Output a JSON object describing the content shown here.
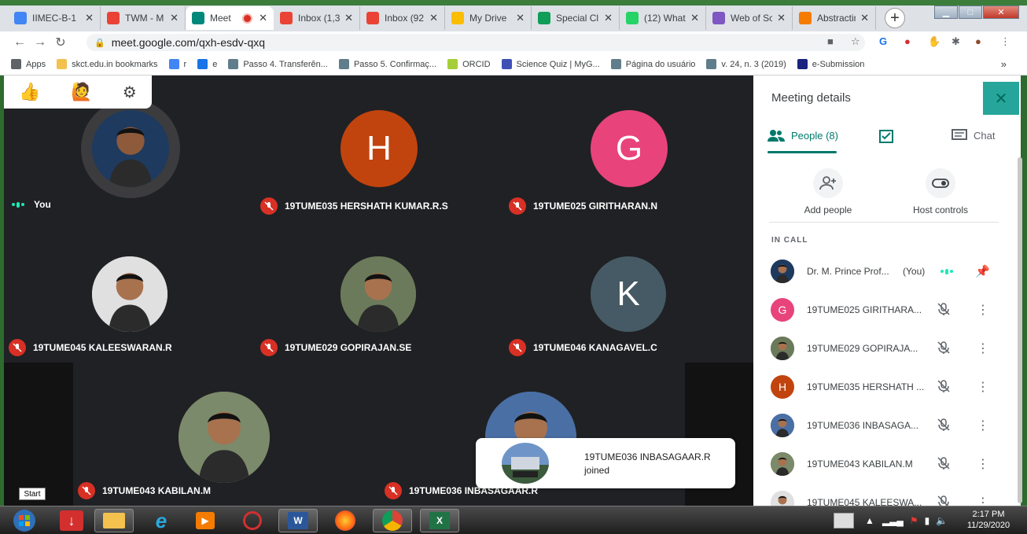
{
  "browser": {
    "tabs": [
      {
        "title": "IIMEC-B-1",
        "icon": "classroom-icon",
        "color": "#4285f4"
      },
      {
        "title": "TWM - M",
        "icon": "gmail-icon",
        "color": "#ea4335"
      },
      {
        "title": "Meet",
        "icon": "meet-icon",
        "color": "#00897b",
        "active": true
      },
      {
        "title": "Inbox (1,3",
        "icon": "gmail-icon",
        "color": "#ea4335"
      },
      {
        "title": "Inbox (92",
        "icon": "gmail-icon",
        "color": "#ea4335"
      },
      {
        "title": "My Drive",
        "icon": "drive-icon",
        "color": "#fbbc04"
      },
      {
        "title": "Special Cl",
        "icon": "sheets-icon",
        "color": "#0f9d58"
      },
      {
        "title": "(12) What",
        "icon": "whatsapp-icon",
        "color": "#25d366"
      },
      {
        "title": "Web of Sc",
        "icon": "wos-icon",
        "color": "#7e57c2"
      },
      {
        "title": "Abstractin",
        "icon": "elsevier-icon",
        "color": "#f57c00"
      }
    ],
    "new_tab": "+",
    "url": "meet.google.com/qxh-esdv-qxq",
    "bookmarks": [
      {
        "label": "Apps",
        "icon": "apps-icon",
        "color": "#5f6368"
      },
      {
        "label": "skct.edu.in bookmarks",
        "icon": "folder-icon",
        "color": "#f2c14e"
      },
      {
        "label": "r",
        "icon": "google-icon",
        "color": "#4285f4"
      },
      {
        "label": "e",
        "icon": "contacts-icon",
        "color": "#1a73e8"
      },
      {
        "label": "Passo 4. Transferên...",
        "icon": "journal-icon",
        "color": "#607d8b"
      },
      {
        "label": "Passo 5. Confirmaç...",
        "icon": "journal-icon",
        "color": "#607d8b"
      },
      {
        "label": "ORCID",
        "icon": "orcid-icon",
        "color": "#a6ce39"
      },
      {
        "label": "Science Quiz | MyG...",
        "icon": "quiz-icon",
        "color": "#3f51b5"
      },
      {
        "label": "Página do usuário",
        "icon": "journal-icon",
        "color": "#607d8b"
      },
      {
        "label": "v. 24, n. 3 (2019)",
        "icon": "journal-icon",
        "color": "#607d8b"
      },
      {
        "label": "e-Submission",
        "icon": "hindawi-icon",
        "color": "#1a237e"
      }
    ],
    "bookmarks_more": "»"
  },
  "stage": {
    "tiles": [
      {
        "name": "You",
        "initial": "",
        "muted": false,
        "speaking": true,
        "photo": true,
        "bg": "#1f3a5f"
      },
      {
        "name": "19TUME035 HERSHATH KUMAR.R.S",
        "initial": "H",
        "muted": true,
        "bg": "#c1440e"
      },
      {
        "name": "19TUME025 GIRITHARAN.N",
        "initial": "G",
        "muted": true,
        "bg": "#e8437a"
      },
      {
        "name": "19TUME045 KALEESWARAN.R",
        "initial": "",
        "muted": true,
        "photo": true,
        "bg": "#e0e0e0"
      },
      {
        "name": "19TUME029 GOPIRAJAN.SE",
        "initial": "",
        "muted": true,
        "photo": true,
        "bg": "#6b7a5a"
      },
      {
        "name": "19TUME046 KANAGAVEL.C",
        "initial": "K",
        "muted": true,
        "bg": "#455a64"
      },
      {
        "name": "19TUME043 KABILAN.M",
        "initial": "",
        "muted": true,
        "photo": true,
        "bg": "#7b8a6a"
      },
      {
        "name": "19TUME036 INBASAGAAR.R",
        "initial": "",
        "muted": true,
        "photo": true,
        "bg": "#4a6fa5"
      }
    ],
    "toast": {
      "line1": "19TUME036 INBASAGAAR.R",
      "line2": "joined"
    },
    "start_tooltip": "Start"
  },
  "panel": {
    "title": "Meeting details",
    "tabs": {
      "people": "People (8)",
      "chat": "Chat"
    },
    "actions": {
      "add": "Add people",
      "host": "Host controls"
    },
    "in_call": "IN CALL",
    "people": [
      {
        "name": "Dr. M. Prince Prof...",
        "suffix": "(You)",
        "initial": "",
        "photo": true,
        "bg": "#1f3a5f"
      },
      {
        "name": "19TUME025 GIRITHARA...",
        "initial": "G",
        "bg": "#e8437a"
      },
      {
        "name": "19TUME029 GOPIRAJA...",
        "initial": "",
        "photo": true,
        "bg": "#6b7a5a"
      },
      {
        "name": "19TUME035 HERSHATH ...",
        "initial": "H",
        "bg": "#c1440e"
      },
      {
        "name": "19TUME036 INBASAGA...",
        "initial": "",
        "photo": true,
        "bg": "#4a6fa5"
      },
      {
        "name": "19TUME043 KABILAN.M",
        "initial": "",
        "photo": true,
        "bg": "#7b8a6a"
      },
      {
        "name": "19TUME045 KALEESWA...",
        "initial": "",
        "photo": true,
        "bg": "#e0e0e0"
      }
    ]
  },
  "taskbar": {
    "time": "2:17 PM",
    "date": "11/29/2020"
  }
}
